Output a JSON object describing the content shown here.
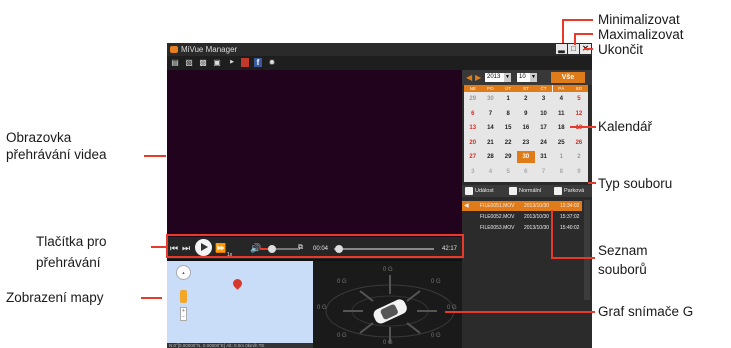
{
  "app": {
    "title": "MiVue Manager",
    "accent_color": "#e07b1a",
    "video_bg_color": "#22031e",
    "toolbar_icons": [
      "folder-open-icon",
      "print-icon",
      "save-icon",
      "camera-icon",
      "youtube-icon",
      "facebook-icon",
      "settings-icon"
    ]
  },
  "calendar": {
    "year": "2013",
    "month": "10",
    "all_label": "Vše",
    "weekdays": [
      "NE",
      "PO",
      "ÚT",
      "ST",
      "ČT",
      "PÁ",
      "SO"
    ],
    "weeks": [
      [
        "29",
        "30",
        "1",
        "2",
        "3",
        "4",
        "5"
      ],
      [
        "6",
        "7",
        "8",
        "9",
        "10",
        "11",
        "12"
      ],
      [
        "13",
        "14",
        "15",
        "16",
        "17",
        "18",
        "19"
      ],
      [
        "20",
        "21",
        "22",
        "23",
        "24",
        "25",
        "26"
      ],
      [
        "27",
        "28",
        "29",
        "30",
        "31",
        "1",
        "2"
      ],
      [
        "3",
        "4",
        "5",
        "6",
        "7",
        "8",
        "9"
      ]
    ],
    "selected_day": "30"
  },
  "file_types": {
    "event": "Událost",
    "normal": "Normální",
    "parking": "Parková"
  },
  "files": [
    {
      "name": "FILE0051.MOV",
      "date": "2013/10/30",
      "time": "15:34:02"
    },
    {
      "name": "FILE0052.MOV",
      "date": "2013/10/30",
      "time": "15:37:02"
    },
    {
      "name": "FILE0053.MOV",
      "date": "2013/10/30",
      "time": "15:40:02"
    }
  ],
  "player": {
    "time_current": "00:04",
    "time_total": "42:17",
    "speed": "1x",
    "volume_fraction": 0.3,
    "progress_fraction": 0.02
  },
  "map": {
    "status": "N:0°[0.00000°N, 0.00000°E]  Alt: 0.0m  0km/h  TE"
  },
  "gsensor": {
    "labels": [
      "0 G",
      "0 G",
      "0 G",
      "0 G",
      "0 G",
      "0 G",
      "0 G",
      "0 G"
    ]
  },
  "callouts": {
    "minimize": "Minimalizovat",
    "maximize": "Maximalizovat",
    "close": "Ukončit",
    "video_screen": [
      "Obrazovka",
      "přehrávání videa"
    ],
    "calendar": "Kalendář",
    "file_type": "Typ souboru",
    "playback_buttons": [
      "Tlačítka pro",
      "přehrávání"
    ],
    "file_list": [
      "Seznam",
      "souborů"
    ],
    "map_view": "Zobrazení mapy",
    "gsensor_graph": "Graf snímače G"
  }
}
